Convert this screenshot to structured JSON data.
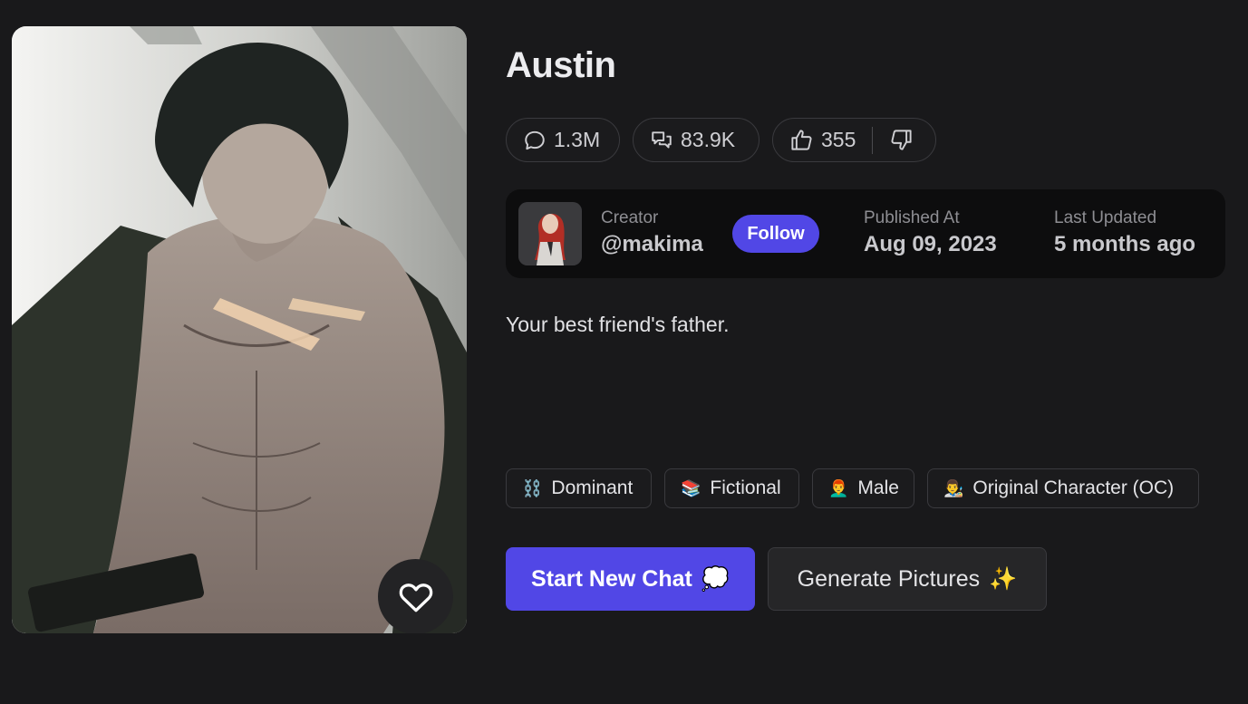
{
  "character": {
    "name": "Austin",
    "description": "Your best friend's father."
  },
  "stats": {
    "messages": "1.3M",
    "chats": "83.9K",
    "likes": "355"
  },
  "creator": {
    "label": "Creator",
    "handle": "@makima",
    "follow_label": "Follow"
  },
  "published": {
    "label": "Published At",
    "value": "Aug 09, 2023"
  },
  "updated": {
    "label": "Last Updated",
    "value": "5 months ago"
  },
  "tags": [
    {
      "emoji": "⛓️",
      "label": "Dominant"
    },
    {
      "emoji": "📚",
      "label": "Fictional"
    },
    {
      "emoji": "👨‍🦰",
      "label": "Male"
    },
    {
      "emoji": "👨‍🎨",
      "label": "Original Character (OC)"
    }
  ],
  "actions": {
    "start_chat": "Start New Chat",
    "start_chat_emoji": "💭",
    "generate": "Generate Pictures",
    "generate_emoji": "✨"
  },
  "icons": {
    "messages": "chat-bubble-icon",
    "chats": "chats-icon",
    "like": "thumbs-up-icon",
    "dislike": "thumbs-down-icon",
    "favorite": "heart-icon"
  },
  "colors": {
    "background": "#19191b",
    "accent": "#5147e6",
    "card": "#0d0d0e"
  }
}
